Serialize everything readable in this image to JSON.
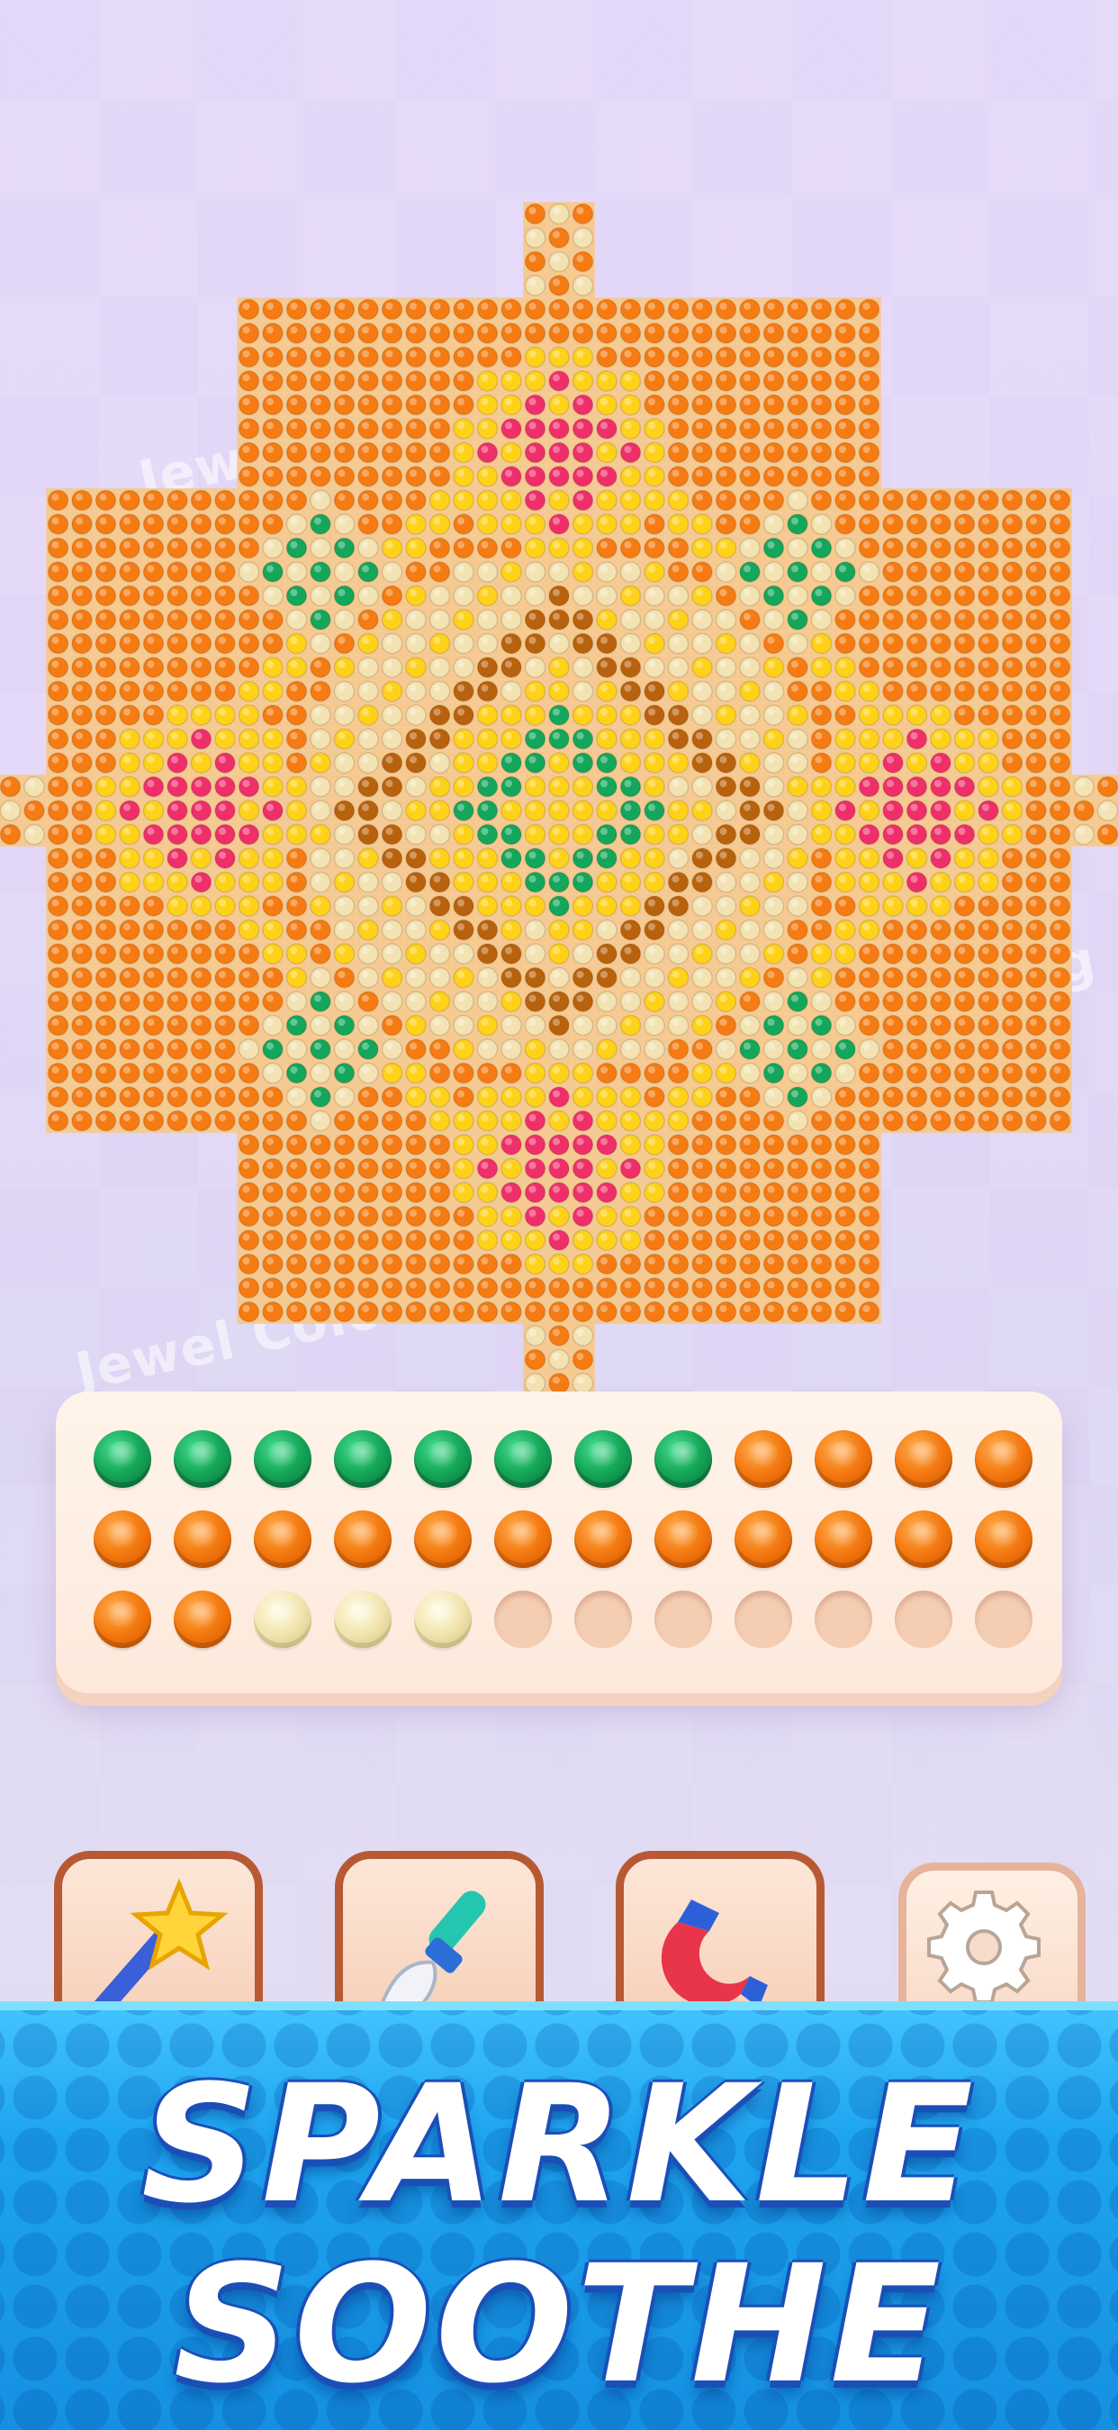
{
  "watermark": {
    "text": "Jewel Coloring"
  },
  "mosaic": {
    "subject": "mandala",
    "palette": {
      "orange": "#f57b12",
      "yellow": "#ffd21a",
      "cream": "#f3e3b3",
      "pink": "#ef2f6a",
      "green": "#14a65a",
      "brown": "#b8620d"
    }
  },
  "tray": {
    "gems": [
      "green",
      "green",
      "green",
      "green",
      "green",
      "green",
      "green",
      "green",
      "orange",
      "orange",
      "orange",
      "orange",
      "orange",
      "orange",
      "orange",
      "orange",
      "orange",
      "orange",
      "orange",
      "orange",
      "orange",
      "orange",
      "orange",
      "orange",
      "orange",
      "orange",
      "cream",
      "cream",
      "cream",
      "empty",
      "empty",
      "empty",
      "empty",
      "empty",
      "empty",
      "empty"
    ]
  },
  "tools": [
    {
      "name": "magic-wand",
      "icon": "magic-wand-icon"
    },
    {
      "name": "brush",
      "icon": "brush-icon"
    },
    {
      "name": "magnet",
      "icon": "magnet-icon"
    },
    {
      "name": "settings",
      "icon": "gear-icon"
    }
  ],
  "banner": {
    "line1": "SPARKLE",
    "line2": "SOOTHE"
  }
}
